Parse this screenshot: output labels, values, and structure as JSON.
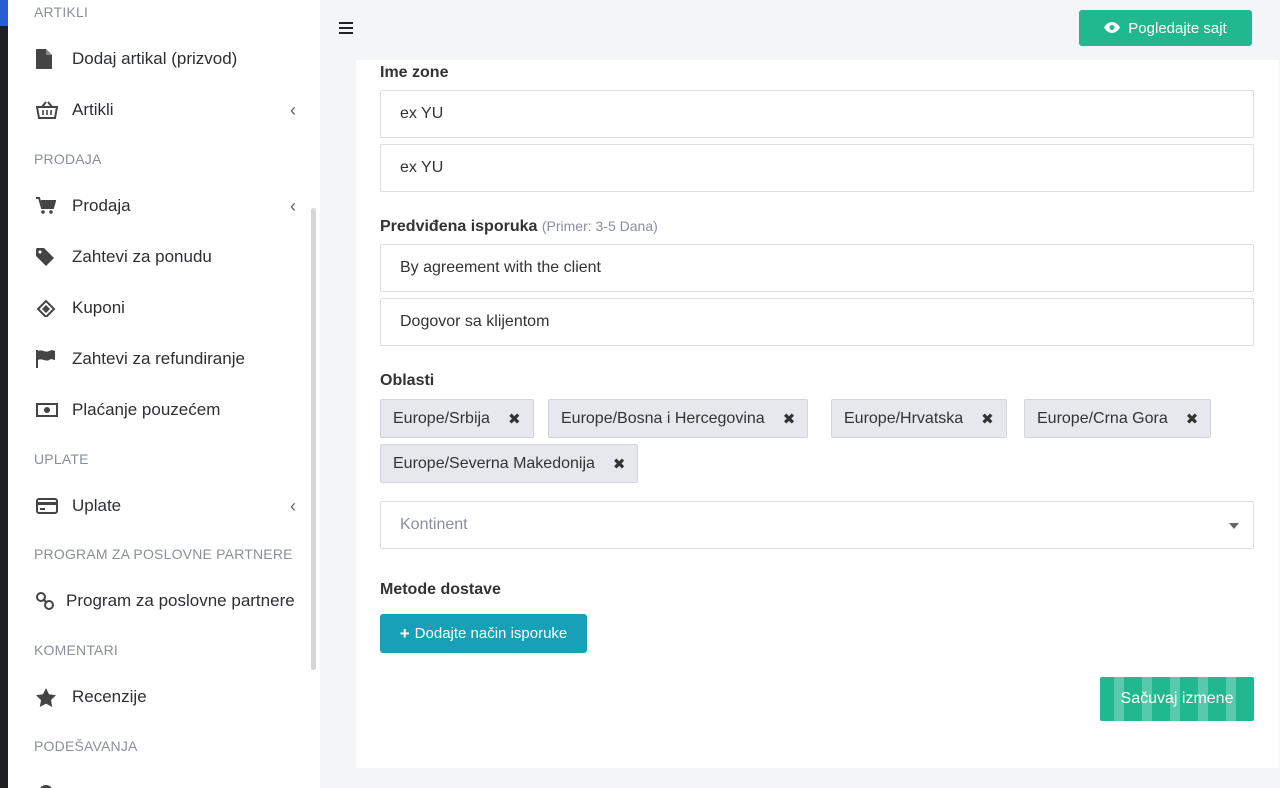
{
  "sidebar": {
    "sections": {
      "artikli": "ARTIKLI",
      "prodaja": "PRODAJA",
      "uplate": "UPLATE",
      "partneri": "PROGRAM ZA POSLOVNE PARTNERE",
      "komentari": "KOMENTARI",
      "podesavanja": "PODEŠAVANJA"
    },
    "items": {
      "dodaj_artikal": "Dodaj artikal (prizvod)",
      "artikli": "Artikli",
      "prodaja": "Prodaja",
      "zahtevi_ponudu": "Zahtevi za ponudu",
      "kuponi": "Kuponi",
      "refundiranje": "Zahtevi za refundiranje",
      "pouzece": "Plaćanje pouzećem",
      "uplate": "Uplate",
      "partneri": "Program za poslovne partnere",
      "recenzije": "Recenzije"
    },
    "chevron": "‹"
  },
  "header": {
    "view_site_label": "Pogledajte sajt"
  },
  "form": {
    "zone_name_label": "Ime zone",
    "zone_name_values": [
      "ex YU",
      "ex YU"
    ],
    "delivery_label": "Predviđena isporuka",
    "delivery_hint": "(Primer: 3-5 Dana)",
    "delivery_values": [
      "By agreement with the client",
      "Dogovor sa klijentom"
    ],
    "regions_label": "Oblasti",
    "regions": [
      "Europe/Srbija",
      "Europe/Bosna i Hercegovina",
      "Europe/Hrvatska",
      "Europe/Crna Gora",
      "Europe/Severna Makedonija"
    ],
    "remove_symbol": "✖",
    "continent_placeholder": "Kontinent",
    "shipping_methods_label": "Metode dostave",
    "add_shipping_label": "Dodajte način isporuke",
    "add_symbol": "+",
    "save_label": "Sačuvaj izmene"
  },
  "colors": {
    "accent_green": "#21b88f",
    "accent_teal": "#17a0b8"
  }
}
